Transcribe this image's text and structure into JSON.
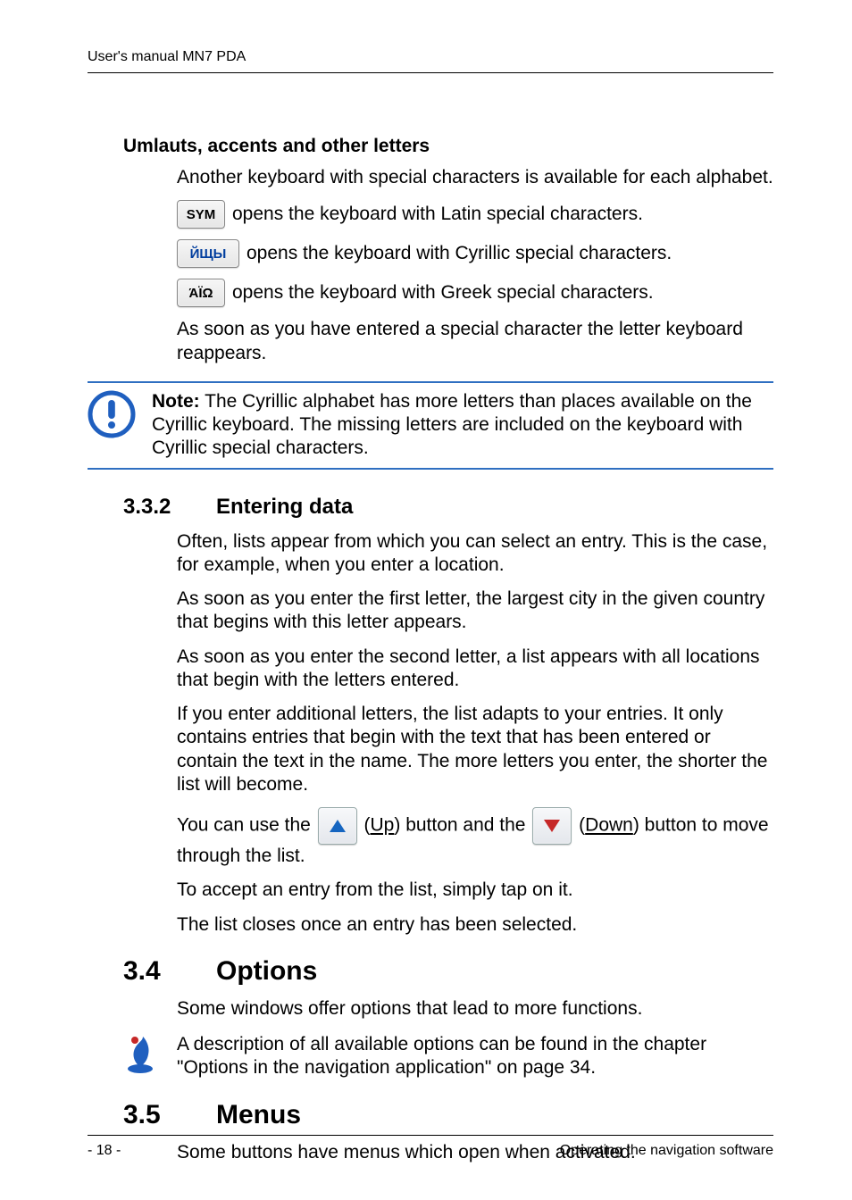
{
  "running_header": "User's manual MN7 PDA",
  "umlauts": {
    "heading": "Umlauts, accents and other letters",
    "intro": "Another keyboard with special characters is available for each alphabet.",
    "sym_glyph": "SYM",
    "sym_text": " opens the keyboard with Latin special characters.",
    "cyr_glyph": "ЙЩЫ",
    "cyr_text": " opens the keyboard with Cyrillic special characters.",
    "grk_glyph": "ΆΪΩ",
    "grk_text": " opens the keyboard with Greek special characters.",
    "close": "As soon as you have entered a special character the letter keyboard reappears."
  },
  "note": {
    "label": "Note:",
    "text": " The Cyrillic alphabet has more letters than places available on the Cyrillic keyboard. The missing letters are included on the keyboard with Cyrillic special characters."
  },
  "sec332": {
    "num": "3.3.2",
    "title": "Entering data",
    "p1": "Often, lists appear from which you can select an entry. This is the case, for example, when you enter a location.",
    "p2": "As soon as you enter the first letter, the largest city in the given country that begins with this letter appears.",
    "p3": "As soon as you enter the second letter, a list appears with all locations that begin with the letters entered.",
    "p4": "If you enter additional letters, the list adapts to your entries. It only contains entries that begin with the text that has been entered or contain the text in the name. The more letters you enter, the shorter the list will become.",
    "p5_a": "You can use the ",
    "p5_up": "Up",
    "p5_b": ") button and the ",
    "p5_down": "Down",
    "p5_c": ") button to move through the list.",
    "p6": "To accept an entry from the list, simply tap on it.",
    "p7": "The list closes once an entry has been selected."
  },
  "sec34": {
    "num": "3.4",
    "title": "Options",
    "p1": "Some windows offer options that lead to more functions.",
    "tip": "A description of all available options can be found in the chapter \"Options in the navigation application\" on page 34."
  },
  "sec35": {
    "num": "3.5",
    "title": "Menus",
    "p1": "Some buttons have menus which open when activated."
  },
  "footer": {
    "left": "- 18 -",
    "right": "Operating the navigation software"
  }
}
